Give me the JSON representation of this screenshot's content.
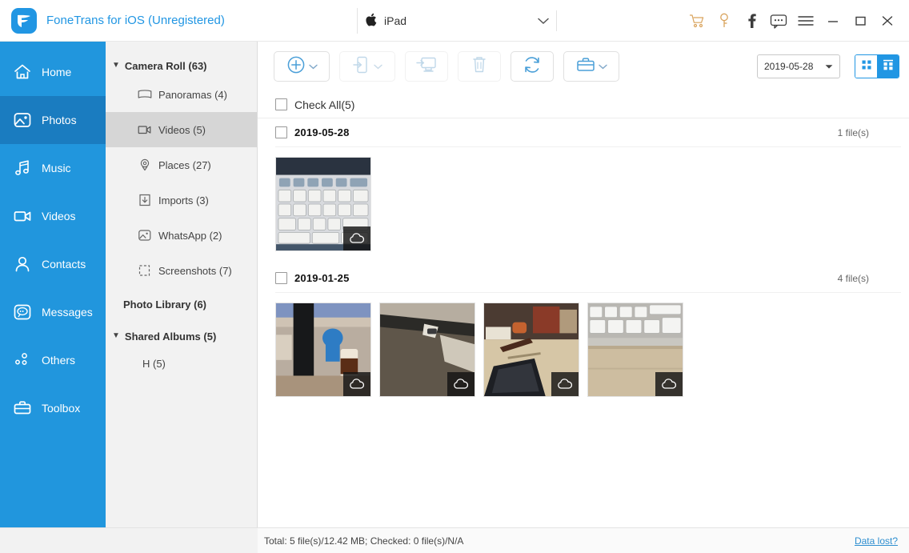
{
  "titlebar": {
    "app_title": "FoneTrans for iOS (Unregistered)",
    "logo_icon": "fonetrans-logo-icon",
    "device": {
      "apple_glyph": "",
      "name": "iPad",
      "chevron_icon": "chevron-down-icon"
    },
    "icons": [
      {
        "name": "cart-icon",
        "color": "#d9a35c"
      },
      {
        "name": "key-icon",
        "color": "#d9a35c"
      },
      {
        "name": "facebook-icon",
        "color": "#3c3c3c"
      },
      {
        "name": "chat-icon",
        "color": "#3c3c3c"
      },
      {
        "name": "menu-icon",
        "color": "#3c3c3c"
      },
      {
        "name": "minimize-icon",
        "color": "#3c3c3c"
      },
      {
        "name": "maximize-icon",
        "color": "#3c3c3c"
      },
      {
        "name": "close-icon",
        "color": "#3c3c3c"
      }
    ]
  },
  "sidebar": {
    "active": "Photos",
    "items": [
      {
        "label": "Home",
        "icon": "home-icon"
      },
      {
        "label": "Photos",
        "icon": "photos-icon"
      },
      {
        "label": "Music",
        "icon": "music-icon"
      },
      {
        "label": "Videos",
        "icon": "video-camera-icon"
      },
      {
        "label": "Contacts",
        "icon": "contacts-icon"
      },
      {
        "label": "Messages",
        "icon": "messages-icon"
      },
      {
        "label": "Others",
        "icon": "others-icon"
      },
      {
        "label": "Toolbox",
        "icon": "toolbox-icon"
      }
    ]
  },
  "albums": {
    "camera_roll": {
      "label": "Camera Roll (63)",
      "caret": "▼"
    },
    "children": [
      {
        "label": "Panoramas (4)",
        "icon": "panorama-icon",
        "selected": false
      },
      {
        "label": "Videos (5)",
        "icon": "video-icon",
        "selected": true
      },
      {
        "label": "Places (27)",
        "icon": "places-pin-icon",
        "selected": false
      },
      {
        "label": "Imports (3)",
        "icon": "import-icon",
        "selected": false
      },
      {
        "label": "WhatsApp (2)",
        "icon": "whatsapp-photo-icon",
        "selected": false
      },
      {
        "label": "Screenshots (7)",
        "icon": "screenshot-icon",
        "selected": false
      }
    ],
    "photo_library": "Photo Library (6)",
    "shared_albums": {
      "label": "Shared Albums (5)",
      "caret": "▼"
    },
    "shared_children": [
      {
        "label": "H (5)"
      }
    ]
  },
  "toolbar": {
    "buttons": [
      {
        "name": "add-button",
        "icon": "plus-circle-icon",
        "has_caret": true,
        "disabled": false
      },
      {
        "name": "export-to-device-button",
        "icon": "export-to-phone-icon",
        "has_caret": true,
        "disabled": true
      },
      {
        "name": "export-to-pc-button",
        "icon": "export-to-pc-icon",
        "has_caret": false,
        "disabled": true
      },
      {
        "name": "delete-button",
        "icon": "trash-icon",
        "has_caret": false,
        "disabled": true
      },
      {
        "name": "refresh-button",
        "icon": "refresh-icon",
        "has_caret": false,
        "disabled": false
      },
      {
        "name": "toolbox-button",
        "icon": "toolbox-icon",
        "has_caret": true,
        "disabled": false
      }
    ],
    "date_filter": {
      "value": "2019-05-28",
      "caret_icon": "caret-down-icon"
    },
    "view_modes": [
      {
        "name": "grid-view-button",
        "icon": "grid-small-icon",
        "active": false
      },
      {
        "name": "group-view-button",
        "icon": "grid-grouped-icon",
        "active": true
      }
    ]
  },
  "content": {
    "check_all_label": "Check All(5)",
    "groups": [
      {
        "date": "2019-05-28",
        "count": "1 file(s)",
        "items": [
          {
            "name": "photo-keyboard-closeup",
            "badge": "cloud-icon"
          }
        ]
      },
      {
        "date": "2019-01-25",
        "count": "4 file(s)",
        "items": [
          {
            "name": "photo-desk-jars",
            "badge": "cloud-icon"
          },
          {
            "name": "photo-dark-edge",
            "badge": "cloud-icon"
          },
          {
            "name": "photo-desk-phone",
            "badge": "cloud-icon"
          },
          {
            "name": "photo-keyboard-desk",
            "badge": "cloud-icon"
          }
        ]
      }
    ]
  },
  "statusbar": {
    "summary": "Total: 5 file(s)/12.42 MB; Checked: 0 file(s)/N/A",
    "data_lost_link": "Data lost?"
  },
  "colors": {
    "brand_blue": "#2196e3",
    "sidebar_blue": "#2196dd",
    "sidebar_active_blue": "#1a7cc0",
    "accent_orange": "#d9a35c",
    "link_blue": "#2f8fd0"
  }
}
